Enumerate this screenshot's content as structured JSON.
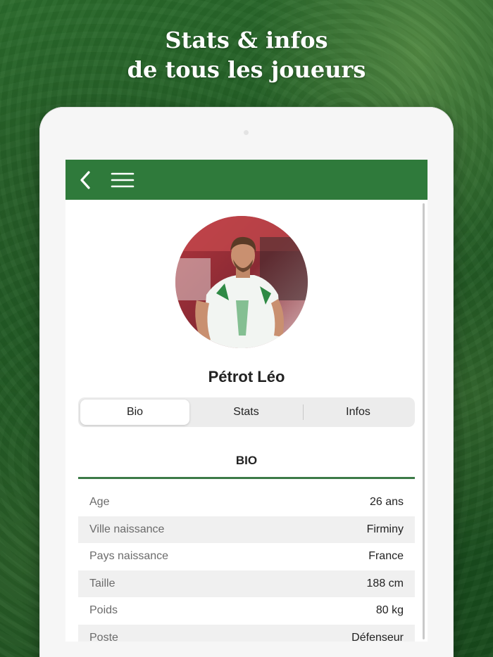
{
  "headline": {
    "line1": "Stats & infos",
    "line2": "de tous les joueurs"
  },
  "header": {
    "back_icon": "chevron-left-icon",
    "menu_icon": "hamburger-menu-icon",
    "color": "#2f7a3b"
  },
  "player": {
    "name": "Pétrot Léo"
  },
  "tabs": [
    {
      "label": "Bio",
      "active": true
    },
    {
      "label": "Stats",
      "active": false
    },
    {
      "label": "Infos",
      "active": false
    }
  ],
  "section": {
    "title": "BIO"
  },
  "bio": [
    {
      "label": "Age",
      "value": "26 ans"
    },
    {
      "label": "Ville naissance",
      "value": "Firminy"
    },
    {
      "label": "Pays naissance",
      "value": "France"
    },
    {
      "label": "Taille",
      "value": "188 cm"
    },
    {
      "label": "Poids",
      "value": "80 kg"
    },
    {
      "label": "Poste",
      "value": "Défenseur"
    }
  ]
}
